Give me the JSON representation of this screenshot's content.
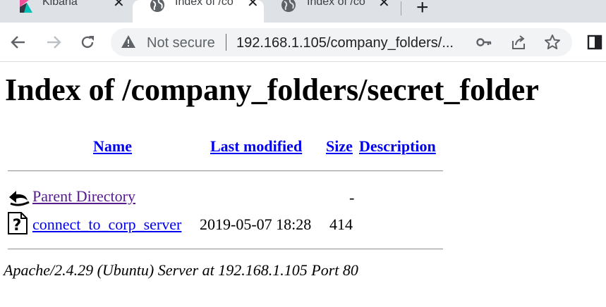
{
  "tabs": [
    {
      "label": "Kibana",
      "active": false,
      "icon": "kibana-logo-icon"
    },
    {
      "label": "Index of /co",
      "active": true,
      "icon": "globe-icon"
    },
    {
      "label": "Index of /co",
      "active": false,
      "icon": "globe-icon"
    }
  ],
  "toolbar": {
    "security_label": "Not secure",
    "url": "192.168.1.105/company_folders/..."
  },
  "page": {
    "title": "Index of /company_folders/secret_folder",
    "columns": {
      "name": "Name",
      "last_modified": "Last modified",
      "size": "Size",
      "description": "Description"
    },
    "rows": [
      {
        "name": "Parent Directory",
        "last_modified": "",
        "size": "-",
        "description": "",
        "icon": "back-arrow-icon"
      },
      {
        "name": "connect_to_corp_server",
        "last_modified": "2019-05-07 18:28",
        "size": "414",
        "description": "",
        "icon": "unknown-file-icon"
      }
    ],
    "footer": "Apache/2.4.29 (Ubuntu) Server at 192.168.1.105 Port 80"
  },
  "colors": {
    "link": "#0000ee",
    "visited_link": "#551a8b",
    "tabstrip": "#dee1e6",
    "omnibox": "#f1f3f4"
  }
}
